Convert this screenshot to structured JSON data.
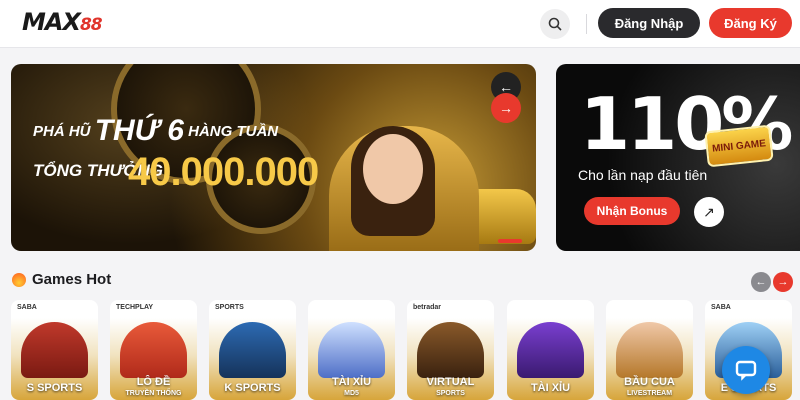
{
  "header": {
    "logo_main": "MAX",
    "logo_accent": "88",
    "login_label": "Đăng Nhập",
    "register_label": "Đăng Ký"
  },
  "banner_main": {
    "line1_a": "PHÁ HŨ",
    "line1_big": "THỨ 6",
    "line1_b": "HÀNG TUẦN",
    "line2": "TỔNG THƯỞNG",
    "amount": "40.000.000",
    "prev_icon": "←",
    "next_icon": "→"
  },
  "banner_side": {
    "percent": "110%",
    "text": "Cho lần nạp đầu tiên",
    "bonus_label": "Nhận Bonus",
    "mini_game": "MINI GAME",
    "arrow_icon": "↗"
  },
  "games_hot": {
    "title": "Games Hot",
    "prev_icon": "←",
    "next_icon": "→",
    "cards": [
      {
        "brand": "SABA",
        "caption": "S SPORTS",
        "sub": ""
      },
      {
        "brand": "TECHPLAY",
        "caption": "LÔ ĐỀ",
        "sub": "TRUYỀN THỐNG"
      },
      {
        "brand": "SPORTS",
        "caption": "K SPORTS",
        "sub": ""
      },
      {
        "brand": "",
        "caption": "TÀI XỈU",
        "sub": "MD5"
      },
      {
        "brand": "betradar",
        "caption": "VIRTUAL",
        "sub": "SPORTS"
      },
      {
        "brand": "",
        "caption": "TÀI XỈU",
        "sub": ""
      },
      {
        "brand": "",
        "caption": "BẦU CUA",
        "sub": "LIVESTREAM"
      },
      {
        "brand": "SABA",
        "caption": "E SPORTS",
        "sub": ""
      }
    ]
  },
  "colors": {
    "accent": "#e8392d",
    "dark": "#2a2a2d",
    "gold": "#f7c948"
  }
}
